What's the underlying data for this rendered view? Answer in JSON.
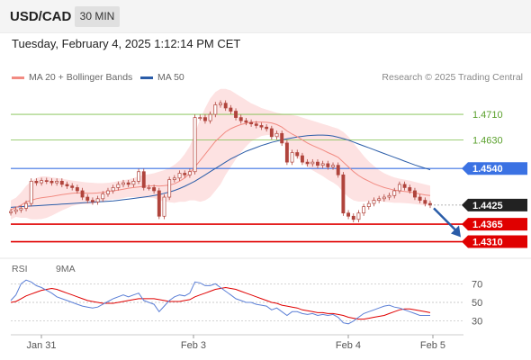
{
  "header": {
    "symbol": "USD/CAD",
    "timeframe": "30 MIN"
  },
  "datetime": "Tuesday, February 4, 2025 1:12:14 PM CET",
  "legend": {
    "ma20_label": "MA 20 + Bollinger Bands",
    "ma50_label": "MA 50",
    "research": "Research © 2025 Trading Central"
  },
  "rsi_legend": {
    "rsi_label": "RSI",
    "ma_label": "9MA"
  },
  "colors": {
    "ma20": "#f28b82",
    "ma50": "#2a5ca8",
    "bollinger_fill": "#fde2e2",
    "level_blue": "#3b72e3",
    "level_red": "#e00000",
    "level_green": "#7cbf4a",
    "price_tag": "#222222",
    "candle": "#b0443c",
    "arrow": "#2a5ca8",
    "rsi": "#5b7fd6",
    "rsi_ma": "#e00000"
  },
  "chart_data": {
    "type": "candlestick",
    "instrument": "USD/CAD",
    "interval": "30 MIN",
    "x_ticks": [
      "Jan 31",
      "Feb 3",
      "Feb 4",
      "Feb 5"
    ],
    "ylim": [
      1.4272,
      1.4795
    ],
    "current_price": "1.4425",
    "levels": [
      {
        "value": 1.471,
        "label": "1.4710",
        "kind": "resistance"
      },
      {
        "value": 1.463,
        "label": "1.4630",
        "kind": "resistance"
      },
      {
        "value": 1.454,
        "label": "1.4540",
        "kind": "pivot"
      },
      {
        "value": 1.4365,
        "label": "1.4365",
        "kind": "support"
      },
      {
        "value": 1.431,
        "label": "1.4310",
        "kind": "support"
      }
    ],
    "price_close": [
      1.4405,
      1.441,
      1.4415,
      1.443,
      1.45,
      1.4495,
      1.4502,
      1.45,
      1.4495,
      1.45,
      1.449,
      1.4485,
      1.448,
      1.447,
      1.445,
      1.444,
      1.4435,
      1.4445,
      1.446,
      1.447,
      1.448,
      1.449,
      1.4495,
      1.449,
      1.45,
      1.453,
      1.448,
      1.448,
      1.447,
      1.439,
      1.445,
      1.4505,
      1.451,
      1.4525,
      1.452,
      1.453,
      1.47,
      1.47,
      1.469,
      1.471,
      1.474,
      1.4745,
      1.473,
      1.472,
      1.47,
      1.469,
      1.4685,
      1.468,
      1.4675,
      1.467,
      1.4665,
      1.464,
      1.465,
      1.462,
      1.456,
      1.459,
      1.458,
      1.456,
      1.4555,
      1.456,
      1.455,
      1.4555,
      1.4545,
      1.455,
      1.452,
      1.44,
      1.439,
      1.438,
      1.44,
      1.442,
      1.443,
      1.444,
      1.4445,
      1.445,
      1.4455,
      1.447,
      1.449,
      1.448,
      1.447,
      1.445,
      1.444,
      1.443,
      1.4425
    ],
    "ma20": [
      1.441,
      1.4418,
      1.4425,
      1.4435,
      1.444,
      1.4445,
      1.4448,
      1.445,
      1.4452,
      1.4455,
      1.4458,
      1.446,
      1.4462,
      1.4463,
      1.4463,
      1.4462,
      1.4462,
      1.4463,
      1.4465,
      1.4468,
      1.447,
      1.4472,
      1.4475,
      1.4478,
      1.448,
      1.4482,
      1.4484,
      1.4485,
      1.4486,
      1.4485,
      1.4486,
      1.4488,
      1.4492,
      1.45,
      1.451,
      1.4525,
      1.4545,
      1.4565,
      1.4585,
      1.4605,
      1.4625,
      1.464,
      1.4655,
      1.4665,
      1.4672,
      1.4678,
      1.4682,
      1.4685,
      1.4686,
      1.4686,
      1.4685,
      1.4683,
      1.4678,
      1.467,
      1.4658,
      1.4648,
      1.464,
      1.463,
      1.462,
      1.4612,
      1.4605,
      1.4598,
      1.459,
      1.4583,
      1.4575,
      1.456,
      1.4545,
      1.453,
      1.4518,
      1.4508,
      1.45,
      1.4492,
      1.4486,
      1.448,
      1.4476,
      1.4472,
      1.447,
      1.4468,
      1.4466,
      1.4463,
      1.446,
      1.4457,
      1.4455
    ],
    "ma50": [
      1.4418,
      1.4419,
      1.442,
      1.4421,
      1.4422,
      1.4423,
      1.4424,
      1.4425,
      1.4426,
      1.4427,
      1.4428,
      1.4429,
      1.443,
      1.4431,
      1.4432,
      1.4433,
      1.4434,
      1.4435,
      1.4436,
      1.4437,
      1.4438,
      1.444,
      1.4442,
      1.4444,
      1.4446,
      1.4448,
      1.445,
      1.4452,
      1.4455,
      1.4458,
      1.4462,
      1.4466,
      1.4471,
      1.4477,
      1.4484,
      1.4492,
      1.45,
      1.451,
      1.452,
      1.453,
      1.454,
      1.455,
      1.456,
      1.457,
      1.4578,
      1.4586,
      1.4594,
      1.46,
      1.4606,
      1.4612,
      1.4617,
      1.4622,
      1.4626,
      1.463,
      1.4633,
      1.4636,
      1.4639,
      1.4641,
      1.4643,
      1.4644,
      1.4645,
      1.4645,
      1.4644,
      1.4642,
      1.4638,
      1.4634,
      1.4629,
      1.4623,
      1.4617,
      1.4611,
      1.4605,
      1.4599,
      1.4593,
      1.4587,
      1.4581,
      1.4575,
      1.4569,
      1.4563,
      1.4557,
      1.4551,
      1.4546,
      1.4541,
      1.4536
    ],
    "bollinger_upper": [
      1.444,
      1.4448,
      1.4465,
      1.4485,
      1.45,
      1.451,
      1.4515,
      1.4515,
      1.4512,
      1.451,
      1.4508,
      1.4505,
      1.4502,
      1.45,
      1.4498,
      1.4496,
      1.4495,
      1.4494,
      1.4494,
      1.4495,
      1.4497,
      1.45,
      1.4503,
      1.4506,
      1.451,
      1.4515,
      1.452,
      1.4522,
      1.4525,
      1.453,
      1.4535,
      1.4542,
      1.4552,
      1.4565,
      1.4585,
      1.461,
      1.465,
      1.4695,
      1.473,
      1.476,
      1.478,
      1.479,
      1.479,
      1.4785,
      1.4775,
      1.4765,
      1.4755,
      1.4745,
      1.4738,
      1.473,
      1.4725,
      1.472,
      1.4715,
      1.4712,
      1.471,
      1.4708,
      1.4705,
      1.47,
      1.4695,
      1.469,
      1.4685,
      1.468,
      1.4675,
      1.467,
      1.4665,
      1.4655,
      1.464,
      1.462,
      1.46,
      1.458,
      1.4562,
      1.4548,
      1.4535,
      1.4525,
      1.4518,
      1.4512,
      1.4508,
      1.4505,
      1.4502,
      1.4498,
      1.4494,
      1.449,
      1.4486
    ],
    "bollinger_lower": [
      1.438,
      1.4388,
      1.4385,
      1.4385,
      1.438,
      1.438,
      1.4381,
      1.4385,
      1.4392,
      1.44,
      1.4408,
      1.4415,
      1.4422,
      1.4426,
      1.4428,
      1.4428,
      1.4429,
      1.4432,
      1.4436,
      1.4441,
      1.4443,
      1.4444,
      1.4447,
      1.445,
      1.445,
      1.4449,
      1.4448,
      1.4448,
      1.4447,
      1.444,
      1.4437,
      1.4434,
      1.4432,
      1.4435,
      1.4435,
      1.444,
      1.444,
      1.4435,
      1.444,
      1.445,
      1.447,
      1.449,
      1.452,
      1.4545,
      1.4569,
      1.4591,
      1.4609,
      1.4625,
      1.4634,
      1.4642,
      1.4645,
      1.4646,
      1.4641,
      1.4628,
      1.4606,
      1.4588,
      1.4575,
      1.456,
      1.4545,
      1.4534,
      1.4525,
      1.4516,
      1.4505,
      1.4496,
      1.4485,
      1.4465,
      1.445,
      1.444,
      1.4436,
      1.4436,
      1.4438,
      1.4436,
      1.4437,
      1.4435,
      1.4434,
      1.4432,
      1.4432,
      1.4431,
      1.443,
      1.4428,
      1.4426,
      1.4424,
      1.4424
    ],
    "forecast_arrow": {
      "from": 1.4415,
      "to": 1.433
    },
    "rsi": {
      "ylim": [
        20,
        80
      ],
      "ticks": [
        70,
        50,
        30
      ],
      "rsi_values": [
        52,
        58,
        70,
        74,
        72,
        68,
        66,
        63,
        60,
        56,
        54,
        52,
        50,
        48,
        46,
        45,
        44,
        45,
        48,
        51,
        54,
        56,
        58,
        56,
        58,
        60,
        52,
        50,
        48,
        40,
        46,
        52,
        56,
        58,
        57,
        60,
        72,
        71,
        68,
        68,
        70,
        66,
        62,
        58,
        54,
        52,
        50,
        50,
        48,
        47,
        46,
        42,
        44,
        40,
        36,
        40,
        40,
        38,
        37,
        38,
        36,
        37,
        36,
        37,
        34,
        28,
        27,
        30,
        34,
        38,
        40,
        42,
        44,
        46,
        47,
        45,
        44,
        42,
        40,
        38,
        36,
        36,
        36
      ],
      "ma_values": [
        50,
        51,
        54,
        57,
        59,
        61,
        63,
        64,
        65,
        64,
        62,
        60,
        58,
        56,
        54,
        52,
        51,
        50,
        49,
        49,
        49,
        50,
        51,
        52,
        53,
        54,
        54,
        54,
        54,
        53,
        52,
        51,
        51,
        51,
        52,
        53,
        56,
        58,
        60,
        62,
        64,
        65,
        66,
        65,
        64,
        62,
        60,
        58,
        56,
        54,
        52,
        50,
        49,
        47,
        46,
        45,
        44,
        42,
        41,
        40,
        39,
        39,
        38,
        38,
        37,
        36,
        34,
        33,
        32,
        32,
        33,
        34,
        35,
        36,
        38,
        40,
        42,
        43,
        43,
        42,
        41,
        40,
        39
      ]
    }
  }
}
